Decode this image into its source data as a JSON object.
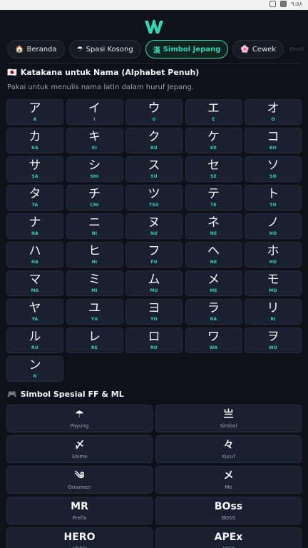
{
  "statusbar": {
    "icon1": "A",
    "time": "٩:٥٨"
  },
  "brand": {
    "accent": "#2fd6b0"
  },
  "tabs": [
    {
      "icon": "🏠",
      "label": "Beranda"
    },
    {
      "icon": "☂",
      "label": "Spasi Kosong"
    },
    {
      "icon": "漢",
      "label": "Simbol Jepang"
    },
    {
      "icon": "🌸",
      "label": "Cewek"
    },
    {
      "icon": "",
      "label": "Emoji"
    }
  ],
  "katakana_section": {
    "flag": "🇯🇵",
    "title": "Katakana untuk Nama (Alphabet Penuh)",
    "subtitle": "Pakai untuk menulis nama latin dalam huruf Jepang."
  },
  "katakana": [
    {
      "ch": "ア",
      "ro": "A"
    },
    {
      "ch": "イ",
      "ro": "I"
    },
    {
      "ch": "ウ",
      "ro": "U"
    },
    {
      "ch": "エ",
      "ro": "E"
    },
    {
      "ch": "オ",
      "ro": "O"
    },
    {
      "ch": "カ",
      "ro": "KA"
    },
    {
      "ch": "キ",
      "ro": "KI"
    },
    {
      "ch": "ク",
      "ro": "KU"
    },
    {
      "ch": "ケ",
      "ro": "KE"
    },
    {
      "ch": "コ",
      "ro": "KO"
    },
    {
      "ch": "サ",
      "ro": "SA"
    },
    {
      "ch": "シ",
      "ro": "SHI"
    },
    {
      "ch": "ス",
      "ro": "SU"
    },
    {
      "ch": "セ",
      "ro": "SE"
    },
    {
      "ch": "ソ",
      "ro": "SO"
    },
    {
      "ch": "タ",
      "ro": "TA"
    },
    {
      "ch": "チ",
      "ro": "CHI"
    },
    {
      "ch": "ツ",
      "ro": "TSU"
    },
    {
      "ch": "テ",
      "ro": "TE"
    },
    {
      "ch": "ト",
      "ro": "TO"
    },
    {
      "ch": "ナ",
      "ro": "NA"
    },
    {
      "ch": "ニ",
      "ro": "NI"
    },
    {
      "ch": "ヌ",
      "ro": "NU"
    },
    {
      "ch": "ネ",
      "ro": "NE"
    },
    {
      "ch": "ノ",
      "ro": "NO"
    },
    {
      "ch": "ハ",
      "ro": "HA"
    },
    {
      "ch": "ヒ",
      "ro": "HI"
    },
    {
      "ch": "フ",
      "ro": "FU"
    },
    {
      "ch": "ヘ",
      "ro": "HE"
    },
    {
      "ch": "ホ",
      "ro": "HO"
    },
    {
      "ch": "マ",
      "ro": "MA"
    },
    {
      "ch": "ミ",
      "ro": "MI"
    },
    {
      "ch": "ム",
      "ro": "MU"
    },
    {
      "ch": "メ",
      "ro": "ME"
    },
    {
      "ch": "モ",
      "ro": "MO"
    },
    {
      "ch": "ヤ",
      "ro": "YA"
    },
    {
      "ch": "ユ",
      "ro": "YU"
    },
    {
      "ch": "ヨ",
      "ro": "YO"
    },
    {
      "ch": "ラ",
      "ro": "RA"
    },
    {
      "ch": "リ",
      "ro": "RI"
    },
    {
      "ch": "ル",
      "ro": "RU"
    },
    {
      "ch": "レ",
      "ro": "RE"
    },
    {
      "ch": "ロ",
      "ro": "RO"
    },
    {
      "ch": "ワ",
      "ro": "WA"
    },
    {
      "ch": "ヲ",
      "ro": "WO"
    },
    {
      "ch": "ン",
      "ro": "N"
    }
  ],
  "special_section": {
    "icon": "🎮",
    "title": "Simbol Spesial FF & ML"
  },
  "symbols": [
    {
      "glyph": "☂",
      "name": "Payung"
    },
    {
      "glyph": "亗",
      "name": "Simbol"
    },
    {
      "glyph": "〆",
      "name": "Shime"
    },
    {
      "glyph": "々",
      "name": "Kuruf"
    },
    {
      "glyph": "༄",
      "name": "Ornamen"
    },
    {
      "glyph": "メ",
      "name": "Me"
    },
    {
      "glyph": "MR",
      "name": "Prefix"
    },
    {
      "glyph": "BOss",
      "name": "BOSS"
    },
    {
      "glyph": "HERO",
      "name": "HERO"
    },
    {
      "glyph": "APEx",
      "name": "APEX"
    }
  ]
}
